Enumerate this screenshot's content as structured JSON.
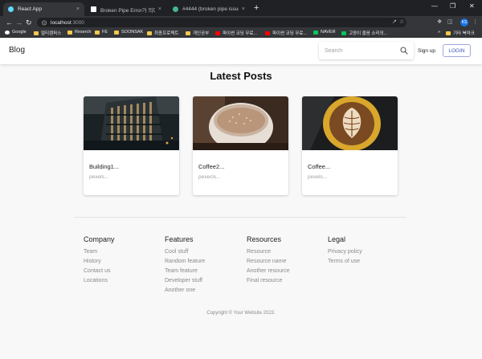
{
  "browser": {
    "tabs": [
      {
        "title": "React App",
        "favicon_color": "#61dafb",
        "active": true
      },
      {
        "title": "Broken Pipe Error가 의미와 대처",
        "favicon_color": "#ffffff",
        "active": false
      },
      {
        "title": "#4444 (broken pipe issue) – Dja",
        "favicon_color": "#44b78b",
        "active": false
      }
    ],
    "tab_close": "×",
    "new_tab": "+",
    "window_controls": [
      "—",
      "❐",
      "✕"
    ],
    "url_host": "localhost",
    "url_port": ":3000",
    "profile_initials": "KS",
    "bookmarks": [
      {
        "label": "Google",
        "icon_color": "#ffffff"
      },
      {
        "label": "멀티캠퍼스",
        "icon_color": "#f2c94c"
      },
      {
        "label": "Reserch",
        "icon_color": "#f2c94c"
      },
      {
        "label": "FE",
        "icon_color": "#f2c94c"
      },
      {
        "label": "SOONSAK",
        "icon_color": "#f2c94c"
      },
      {
        "label": "최종프로젝트",
        "icon_color": "#f2c94c"
      },
      {
        "label": "개인공부",
        "icon_color": "#f2c94c"
      },
      {
        "label": "파이썬 코딩 무료...",
        "icon_color": "#ff0000"
      },
      {
        "label": "파이썬 코딩 무료...",
        "icon_color": "#ff0000"
      },
      {
        "label": "NAVER",
        "icon_color": "#03c75a"
      },
      {
        "label": "고양이 울음 소리의...",
        "icon_color": "#03c75a"
      }
    ],
    "bookmarks_overflow": "»",
    "other_bookmarks": "기타 북마크"
  },
  "appbar": {
    "brand": "Blog",
    "search_placeholder": "Search",
    "signup_label": "Sign up",
    "login_label": "LOGIN"
  },
  "main": {
    "title": "Latest Posts",
    "posts": [
      {
        "title": "Building1...",
        "subtitle": "pexels...",
        "image": "building"
      },
      {
        "title": "Coffee2...",
        "subtitle": "pexecls...",
        "image": "coffee-cup"
      },
      {
        "title": "Coffee...",
        "subtitle": "pexels...",
        "image": "latte-art"
      }
    ]
  },
  "footer": {
    "columns": [
      {
        "heading": "Company",
        "links": [
          "Team",
          "History",
          "Contact us",
          "Locations"
        ]
      },
      {
        "heading": "Features",
        "links": [
          "Cool stuff",
          "Random feature",
          "Team feature",
          "Developer stuff",
          "Another one"
        ]
      },
      {
        "heading": "Resources",
        "links": [
          "Resource",
          "Resource name",
          "Another resource",
          "Final resource"
        ]
      },
      {
        "heading": "Legal",
        "links": [
          "Privacy policy",
          "Terms of use"
        ]
      }
    ],
    "copyright": "Copyright © Your Website 2023."
  }
}
